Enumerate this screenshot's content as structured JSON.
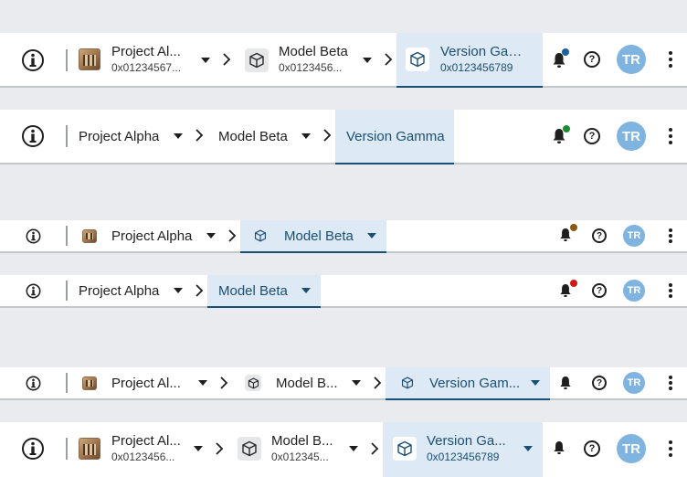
{
  "accent_color": "#1b4f72",
  "icons": {
    "logo": "info-logo-icon",
    "bell": "bell-icon",
    "help": "help-icon",
    "more": "kebab-menu-icon",
    "chevron": "chevron-right-icon",
    "caret": "caret-down-icon",
    "model": "cube-icon",
    "project": "project-thumbnail"
  },
  "bars": [
    {
      "project": {
        "name": "Project Al...",
        "id": "0x01234567..."
      },
      "model": {
        "name": "Model Beta",
        "id": "0x0123456..."
      },
      "version": {
        "name": "Version Gamm...",
        "id": "0x0123456789"
      },
      "notification_dot_color": "#1a5fa8",
      "user_initials": "TR"
    },
    {
      "project": {
        "name": "Project Alpha"
      },
      "model": {
        "name": "Model Beta"
      },
      "version": {
        "name": "Version Gamma"
      },
      "notification_dot_color": "#1e8a2e",
      "user_initials": "TR"
    },
    {
      "project": {
        "name": "Project Alpha"
      },
      "model": {
        "name": "Model Beta"
      },
      "notification_dot_color": "#8a5a12",
      "user_initials": "TR"
    },
    {
      "project": {
        "name": "Project Alpha"
      },
      "model": {
        "name": "Model Beta"
      },
      "notification_dot_color": "#d01a1a",
      "user_initials": "TR"
    },
    {
      "project": {
        "name": "Project Al..."
      },
      "model": {
        "name": "Model B..."
      },
      "version": {
        "name": "Version Gam..."
      },
      "user_initials": "TR"
    },
    {
      "project": {
        "name": "Project Al...",
        "id": "0x0123456..."
      },
      "model": {
        "name": "Model B...",
        "id": "0x012345..."
      },
      "version": {
        "name": "Version Ga...",
        "id": "0x0123456789"
      },
      "user_initials": "TR"
    }
  ]
}
